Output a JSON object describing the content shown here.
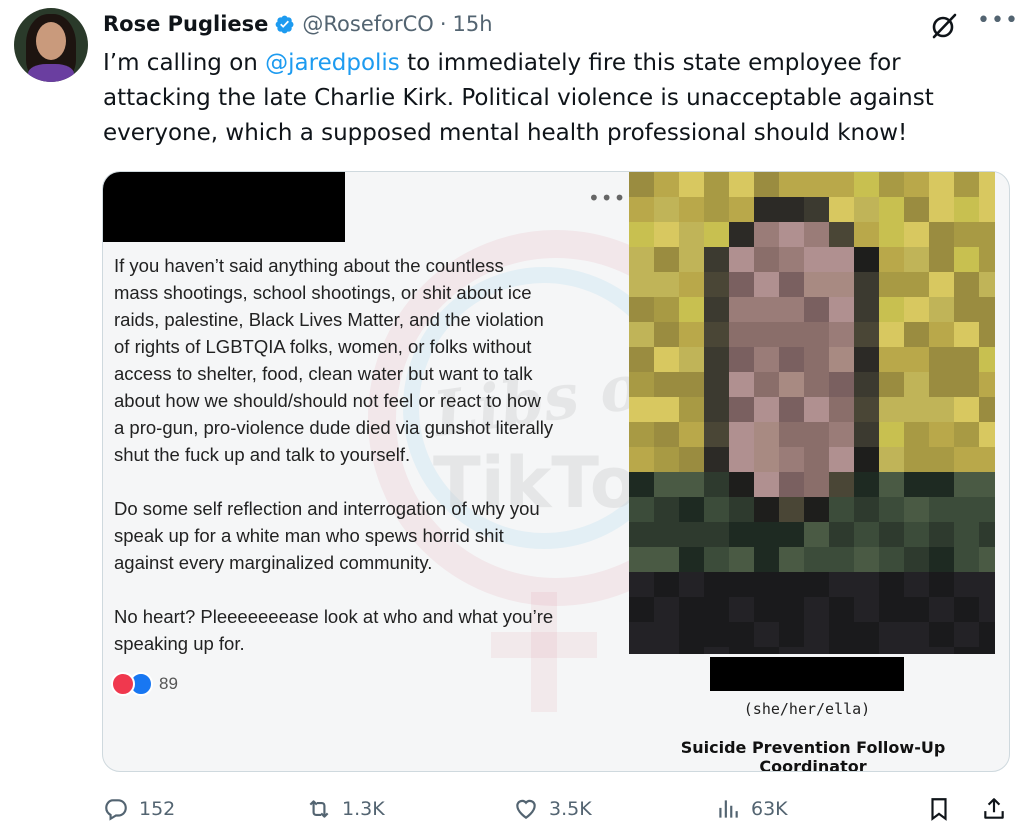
{
  "author": {
    "name": "Rose Pugliese",
    "handle": "@RoseforCO",
    "separator": "·",
    "time": "15h"
  },
  "tweet": {
    "text_before": "I’m calling on ",
    "mention": "@jaredpolis",
    "text_after": " to immediately fire this state employee for attacking the late Charlie Kirk. Political violence is unacceptable against everyone, which a supposed mental health professional should know!"
  },
  "embedded_post": {
    "paragraphs": [
      "If you haven’t said anything about the countless\nmass shootings, school shootings, or shit about ice\nraids, palestine, Black Lives Matter, and the violation\nof rights of LGBTQIA folks, women, or folks without\naccess to shelter, food, clean water  but want to talk\nabout how we should/should not feel or react to how\na pro-gun, pro-violence dude died via gunshot  literally\nshut the fuck up and talk to yourself.",
      "Do some self reflection and interrogation of why you\nspeak up for a white man who spews horrid shit\nagainst every marginalized community.",
      "No heart? Pleeeeeeease look at who and what you’re\nspeaking up for."
    ],
    "reaction_count": "89",
    "pronouns": "(she/her/ella)",
    "job_title": "Suicide Prevention Follow-Up Coordinator",
    "watermark_line1": "Libs of",
    "watermark_line2": "TikTok"
  },
  "actions": {
    "replies": "152",
    "reposts": "1.3K",
    "likes": "3.5K",
    "views": "63K"
  },
  "colors": {
    "link": "#1d9bf0",
    "muted": "#536471",
    "verified": "#1d9bf0"
  },
  "icons": [
    "verified-badge-icon",
    "grok-icon",
    "more-icon",
    "reply-icon",
    "repost-icon",
    "like-icon",
    "views-icon",
    "bookmark-icon",
    "share-icon"
  ]
}
